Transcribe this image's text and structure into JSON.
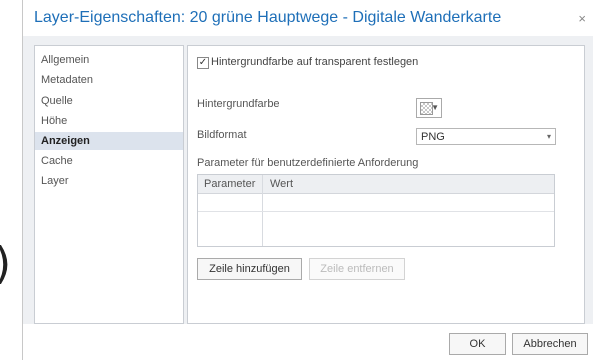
{
  "edge_glyph": ")",
  "dialog": {
    "title": "Layer-Eigenschaften: 20 grüne Hauptwege - Digitale Wanderkarte",
    "close_glyph": "×"
  },
  "sidebar": {
    "items": [
      {
        "label": "Allgemein",
        "active": false
      },
      {
        "label": "Metadaten",
        "active": false
      },
      {
        "label": "Quelle",
        "active": false
      },
      {
        "label": "Höhe",
        "active": false
      },
      {
        "label": "Anzeigen",
        "active": true
      },
      {
        "label": "Cache",
        "active": false
      },
      {
        "label": "Layer",
        "active": false
      }
    ]
  },
  "panel": {
    "transparent_checkbox": {
      "label": "Hintergrundfarbe auf transparent festlegen",
      "checked": true,
      "check_glyph": "✓"
    },
    "bg_color_label": "Hintergrundfarbe",
    "format_label": "Bildformat",
    "format_value": "PNG",
    "params_label": "Parameter für benutzerdefinierte Anforderung",
    "grid": {
      "columns": [
        "Parameter",
        "Wert"
      ]
    },
    "add_row_button": "Zeile hinzufügen",
    "remove_row_button": "Zeile entfernen"
  },
  "footer": {
    "ok_button": "OK",
    "cancel_button": "Abbrechen"
  },
  "colors": {
    "title": "#1e6fb8",
    "active_item_bg": "#dce3ed",
    "body_bg": "#eef0f3"
  }
}
